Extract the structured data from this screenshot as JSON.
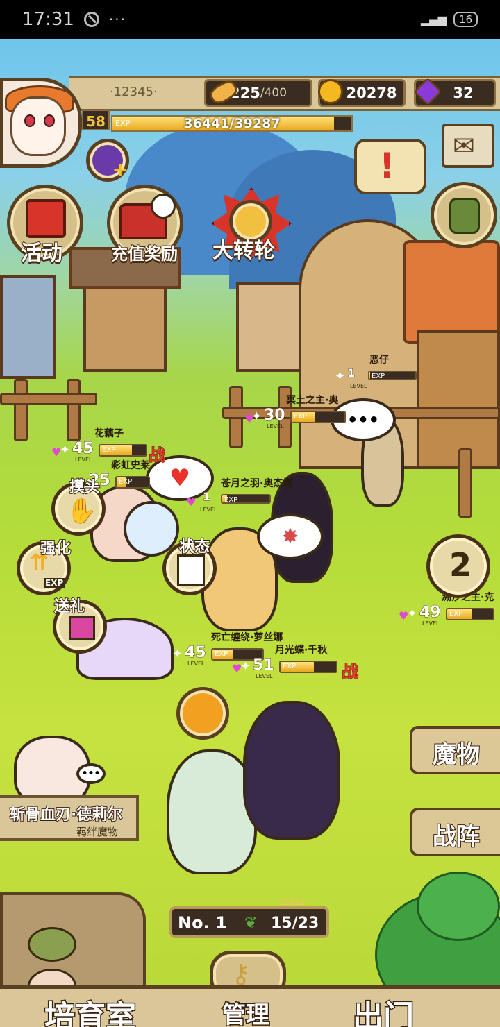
{
  "status_bar": {
    "time": "17:31",
    "dots": "···",
    "battery": "16"
  },
  "player": {
    "id": "·12345·",
    "level": "58",
    "exp_label": "EXP",
    "exp_value": "36441/39287",
    "exp_fraction": 0.928
  },
  "resources": {
    "stamina": {
      "current": "225",
      "max": "/400"
    },
    "gold": "20278",
    "gems": "32"
  },
  "menu": {
    "activity": "活动",
    "recharge": "充值奖励",
    "wheel": "大转轮"
  },
  "characters": [
    {
      "name": "恶仔",
      "level": "1",
      "exp_fraction": 0.02
    },
    {
      "name": "冥土之主·奥",
      "level": "30",
      "exp_fraction": 0.45
    },
    {
      "name": "花藕子",
      "level": "45",
      "exp_fraction": 0.7,
      "fight": "战"
    },
    {
      "name": "彩虹史莱",
      "level": "25",
      "exp_fraction": 0.3
    },
    {
      "name": "苍月之羽·奥杰塔",
      "level": "1",
      "exp_fraction": 0.1
    },
    {
      "name": "溯汐之主·克",
      "level": "49",
      "exp_fraction": 0.55
    },
    {
      "name": "死亡缠绕·萝丝娜",
      "level": "45",
      "exp_fraction": 0.4
    },
    {
      "name": "月光蝶·千秋",
      "level": "51",
      "exp_fraction": 0.6,
      "fight": "战"
    }
  ],
  "level_word": "LEVEL",
  "exp_word": "EXP",
  "bubbles": {
    "ellipsis": "•••"
  },
  "actions": {
    "pet": "摸头",
    "strengthen": "强化",
    "status": "状态",
    "gift": "送礼",
    "exp_badge": "EXP"
  },
  "page_indicator": "2",
  "featured": {
    "name": "斩骨血刃·德莉尔",
    "subtitle": "羁绊魔物"
  },
  "right_menu": {
    "monsters": "魔物",
    "formation": "战阵"
  },
  "space": {
    "rank_prefix": "No.",
    "rank": "1",
    "label": "SPACE",
    "count": "15/23"
  },
  "bottom_nav": {
    "nursery": "培育室",
    "manage": "管理",
    "go_out": "出门"
  },
  "colors": {
    "accent": "#e9a820",
    "panel": "#d9c699",
    "dark": "#3a2c20"
  }
}
